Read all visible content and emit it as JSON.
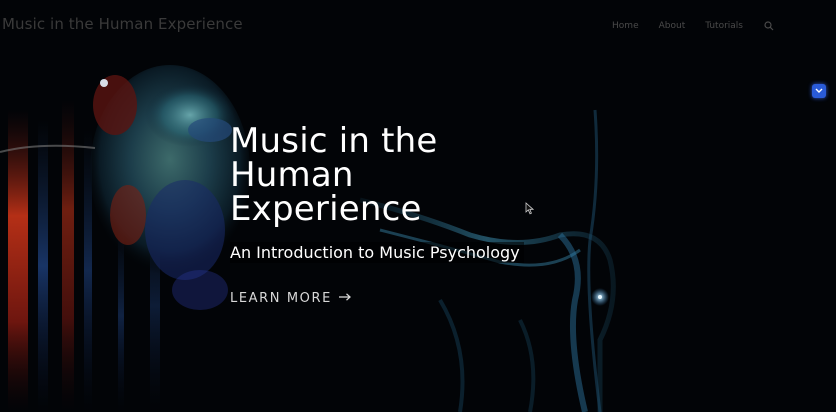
{
  "site": {
    "title": "Music in the Human Experience"
  },
  "nav": {
    "items": [
      {
        "label": "Home"
      },
      {
        "label": "About"
      },
      {
        "label": "Tutorials"
      }
    ],
    "search_icon": "search-icon"
  },
  "hero": {
    "title": "Music in the Human Experience",
    "subtitle": "An Introduction to Music Psychology",
    "cta_label": "LEARN MORE",
    "cta_icon": "arrow-right-icon"
  },
  "colors": {
    "background": "#020407",
    "hero_text": "#ffffff",
    "header_text": "#3a3a3a",
    "badge": "#2a5bd8"
  }
}
